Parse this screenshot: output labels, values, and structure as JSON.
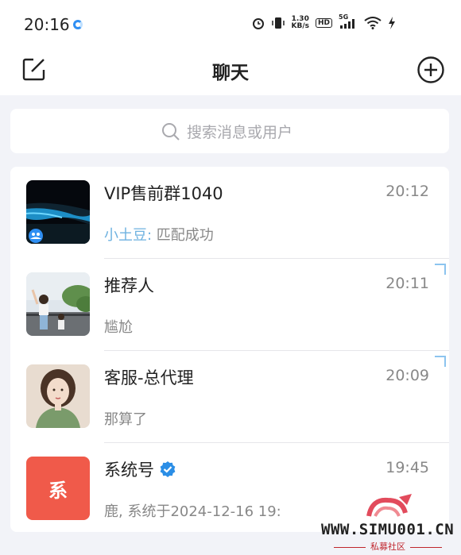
{
  "status_bar": {
    "time": "20:16",
    "network_speed_value": "1.30",
    "network_speed_unit": "KB/s",
    "hd_label": "HD",
    "network_type": "5G"
  },
  "header": {
    "title": "聊天",
    "compose_icon": "compose-icon",
    "add_icon": "plus-circle-icon"
  },
  "search": {
    "placeholder": "搜索消息或用户",
    "icon": "search-icon"
  },
  "chats": [
    {
      "name": "VIP售前群1040",
      "time": "20:12",
      "sender": "小土豆:",
      "message": " 匹配成功"
    },
    {
      "name": "推荐人",
      "time": "20:11",
      "message": "尴尬"
    },
    {
      "name": "客服-总代理",
      "time": "20:09",
      "message": "那算了"
    },
    {
      "name": "系统号",
      "time": "19:45",
      "avatar_text": "系",
      "message": "鹿,      系统于2024-12-16 19:"
    }
  ],
  "watermark": {
    "text": "WWW.SIMU001.CN",
    "subtitle": "私募社区"
  },
  "colors": {
    "accent_blue": "#2f8ff3",
    "sender_blue": "#6fb2e0",
    "system_avatar_red": "#f05a4a",
    "verified_blue": "#2b8ee6"
  }
}
